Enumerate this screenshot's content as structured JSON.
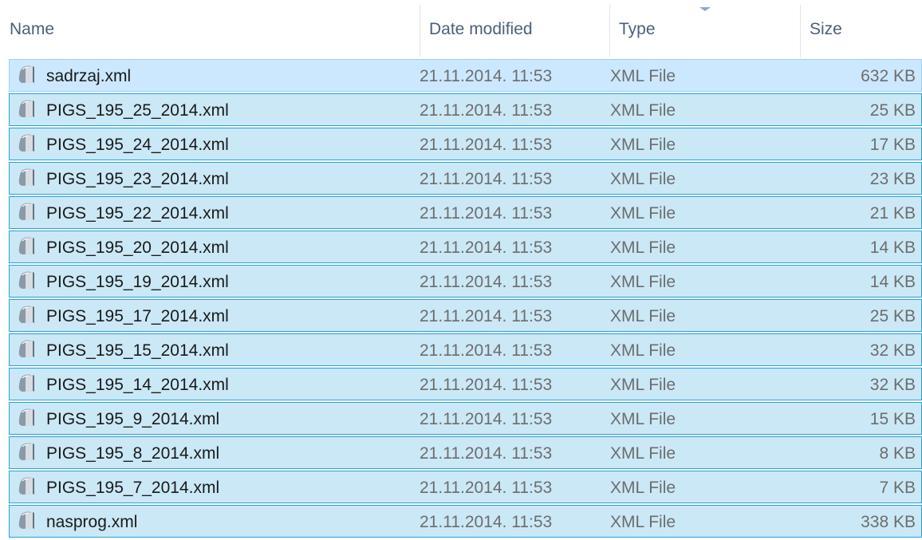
{
  "header": {
    "name": "Name",
    "date_modified": "Date modified",
    "type": "Type",
    "size": "Size"
  },
  "sort": {
    "column": "Type",
    "indicator_icon": "sort-indicator-icon"
  },
  "file_icon": "xml-file-icon",
  "colors": {
    "selection_fill": "#cbe8f6",
    "selection_border": "#26a0da",
    "focus_fill": "#cce8ff",
    "header_text": "#4c607a"
  },
  "files": [
    {
      "name": "sadrzaj.xml",
      "date": "21.11.2014. 11:53",
      "type": "XML File",
      "size": "632 KB"
    },
    {
      "name": "PIGS_195_25_2014.xml",
      "date": "21.11.2014. 11:53",
      "type": "XML File",
      "size": "25 KB"
    },
    {
      "name": "PIGS_195_24_2014.xml",
      "date": "21.11.2014. 11:53",
      "type": "XML File",
      "size": "17 KB"
    },
    {
      "name": "PIGS_195_23_2014.xml",
      "date": "21.11.2014. 11:53",
      "type": "XML File",
      "size": "23 KB"
    },
    {
      "name": "PIGS_195_22_2014.xml",
      "date": "21.11.2014. 11:53",
      "type": "XML File",
      "size": "21 KB"
    },
    {
      "name": "PIGS_195_20_2014.xml",
      "date": "21.11.2014. 11:53",
      "type": "XML File",
      "size": "14 KB"
    },
    {
      "name": "PIGS_195_19_2014.xml",
      "date": "21.11.2014. 11:53",
      "type": "XML File",
      "size": "14 KB"
    },
    {
      "name": "PIGS_195_17_2014.xml",
      "date": "21.11.2014. 11:53",
      "type": "XML File",
      "size": "25 KB"
    },
    {
      "name": "PIGS_195_15_2014.xml",
      "date": "21.11.2014. 11:53",
      "type": "XML File",
      "size": "32 KB"
    },
    {
      "name": "PIGS_195_14_2014.xml",
      "date": "21.11.2014. 11:53",
      "type": "XML File",
      "size": "32 KB"
    },
    {
      "name": "PIGS_195_9_2014.xml",
      "date": "21.11.2014. 11:53",
      "type": "XML File",
      "size": "15 KB"
    },
    {
      "name": "PIGS_195_8_2014.xml",
      "date": "21.11.2014. 11:53",
      "type": "XML File",
      "size": "8 KB"
    },
    {
      "name": "PIGS_195_7_2014.xml",
      "date": "21.11.2014. 11:53",
      "type": "XML File",
      "size": "7 KB"
    },
    {
      "name": "nasprog.xml",
      "date": "21.11.2014. 11:53",
      "type": "XML File",
      "size": "338 KB"
    }
  ]
}
